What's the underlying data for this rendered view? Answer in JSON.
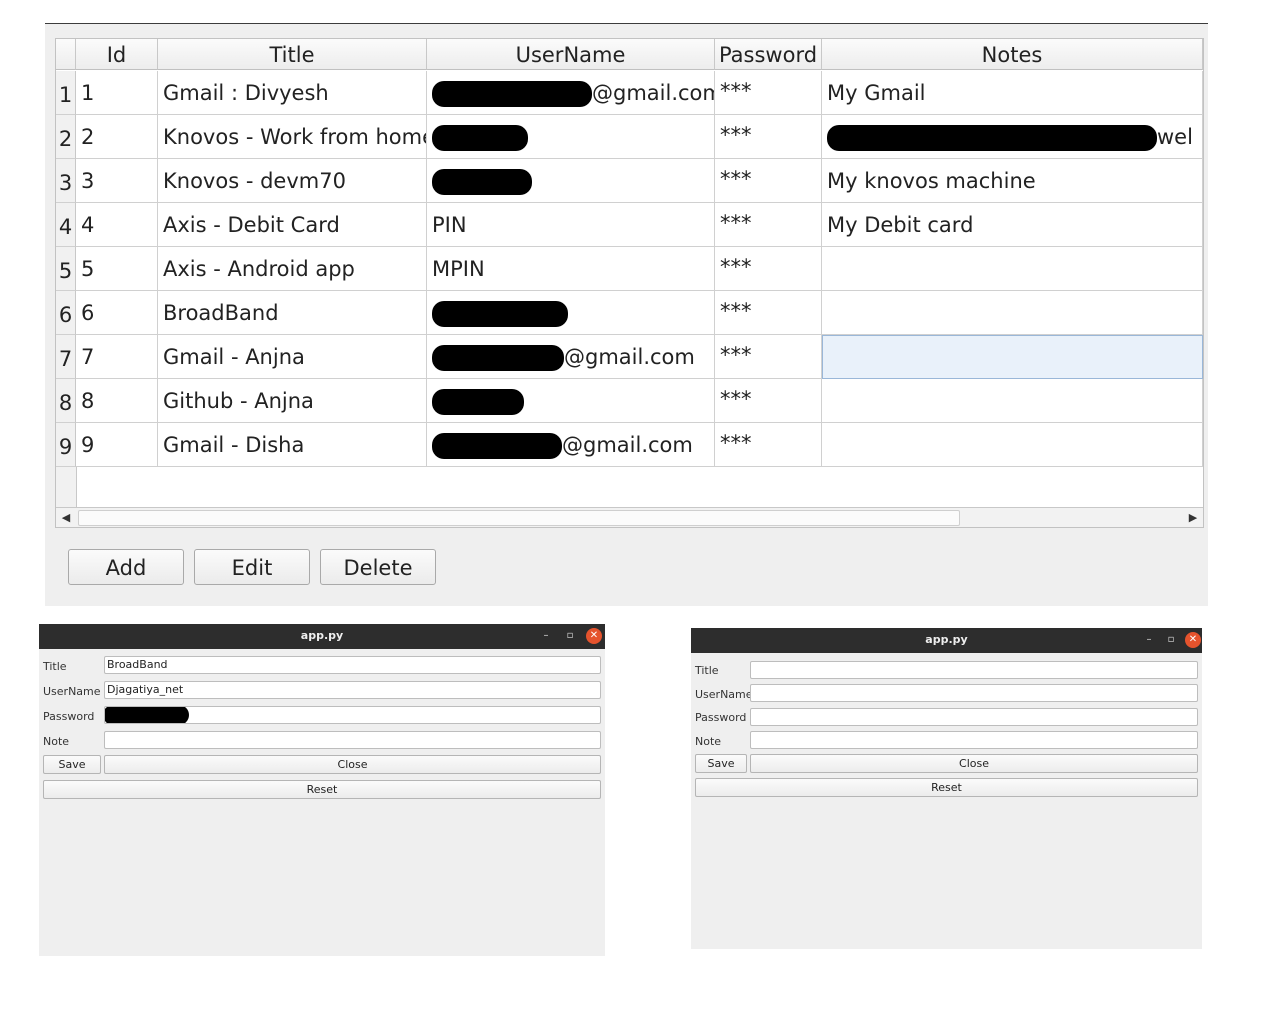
{
  "table": {
    "columns": [
      "Id",
      "Title",
      "UserName",
      "Password",
      "Notes"
    ],
    "rows": [
      {
        "row_num": "1",
        "id": "1",
        "title": "Gmail : Divyesh",
        "username": "@gmail.com",
        "password": "***",
        "notes": "My Gmail"
      },
      {
        "row_num": "2",
        "id": "2",
        "title": "Knovos - Work from home",
        "username": "",
        "password": "***",
        "notes": "wel"
      },
      {
        "row_num": "3",
        "id": "3",
        "title": "Knovos - devm70",
        "username": "",
        "password": "***",
        "notes": "My knovos machine"
      },
      {
        "row_num": "4",
        "id": "4",
        "title": "Axis - Debit Card",
        "username": "PIN",
        "password": "***",
        "notes": "My Debit card"
      },
      {
        "row_num": "5",
        "id": "5",
        "title": "Axis - Android app",
        "username": "MPIN",
        "password": "***",
        "notes": ""
      },
      {
        "row_num": "6",
        "id": "6",
        "title": "BroadBand",
        "username": "",
        "password": "***",
        "notes": ""
      },
      {
        "row_num": "7",
        "id": "7",
        "title": "Gmail - Anjna",
        "username": "@gmail.com",
        "password": "***",
        "notes": ""
      },
      {
        "row_num": "8",
        "id": "8",
        "title": "Github - Anjna",
        "username": "",
        "password": "***",
        "notes": ""
      },
      {
        "row_num": "9",
        "id": "9",
        "title": "Gmail - Disha",
        "username": "@gmail.com",
        "password": "***",
        "notes": ""
      }
    ],
    "selected_row": 7,
    "scroll": {
      "left_arrow": "◀",
      "right_arrow": "▶"
    }
  },
  "buttons": {
    "add": "Add",
    "edit": "Edit",
    "delete": "Delete"
  },
  "dialog_filled": {
    "window_title": "app.py",
    "labels": {
      "title": "Title",
      "username": "UserName",
      "password": "Password",
      "note": "Note"
    },
    "values": {
      "title": "BroadBand",
      "username": "Djagatiya_net",
      "password": "",
      "note": ""
    },
    "buttons": {
      "save": "Save",
      "close": "Close",
      "reset": "Reset"
    },
    "titlebar_icons": {
      "minimize": "–",
      "maximize": "▫",
      "close": "✕"
    }
  },
  "dialog_empty": {
    "window_title": "app.py",
    "labels": {
      "title": "Title",
      "username": "UserName",
      "password": "Password",
      "note": "Note"
    },
    "values": {
      "title": "",
      "username": "",
      "password": "",
      "note": ""
    },
    "buttons": {
      "save": "Save",
      "close": "Close",
      "reset": "Reset"
    },
    "titlebar_icons": {
      "minimize": "–",
      "maximize": "▫",
      "close": "✕"
    }
  },
  "colors": {
    "close_button": "#e5532d",
    "titlebar": "#2d2d2d",
    "selection": "#e9f1fa"
  }
}
